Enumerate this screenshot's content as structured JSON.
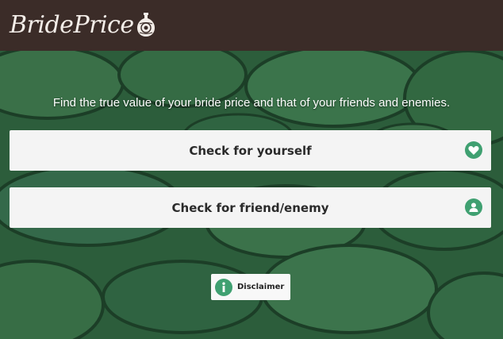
{
  "header": {
    "logo_text": "BridePrice",
    "logo_icon": "pot-icon",
    "background": "#3b2c28"
  },
  "main": {
    "tagline": "Find the true value of your bride price and that of your friends and enemies.",
    "options": [
      {
        "label": "Check for yourself",
        "icon": "heart-icon"
      },
      {
        "label": "Check for friend/enemy",
        "icon": "user-icon"
      }
    ],
    "disclaimer": {
      "label": "Disclaimer",
      "icon": "info-icon"
    }
  },
  "colors": {
    "accent": "#3fa071",
    "background": "#2e5f3d",
    "card": "#f4f4f4"
  }
}
